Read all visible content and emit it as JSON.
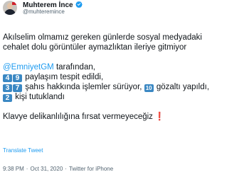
{
  "user": {
    "name": "Muhterem İnce",
    "handle": "@muhteremince"
  },
  "tweet": {
    "line1": "Akılselim olmamız gereken günlerde sosyal medyadaki",
    "line2": "cehalet dolu görüntüler aymazlıktan ileriye gitmiyor",
    "mention": "@EmniyetGM",
    "mention_suffix": " tarafından,",
    "l4_d1": "4",
    "l4_d2": "9",
    "l4_text": " paylaşım tespit edildi,",
    "l5_d1": "3",
    "l5_d2": "7",
    "l5_text": " şahıs hakkında işlemler sürüyor, ",
    "l5_num": "10",
    "l5_text2": " gözaltı yapıldı,",
    "l6_d1": "2",
    "l6_text": " kişi tutuklandı",
    "closing": "Klavye delikanlılığına fırsat vermeyeceğiz",
    "exclaim": "❗"
  },
  "translate_label": "Translate Tweet",
  "footer": {
    "time": "9:38 PM",
    "sep": "·",
    "date": "Oct 31, 2020",
    "source": "Twitter for iPhone"
  },
  "colors": {
    "link": "#1d9bf0",
    "keycap": "#3b88c3",
    "secondary_text": "#536471",
    "verified": "#1d9bf0"
  },
  "icons": {
    "verified": "verified-badge-icon",
    "avatar": "profile-photo"
  }
}
